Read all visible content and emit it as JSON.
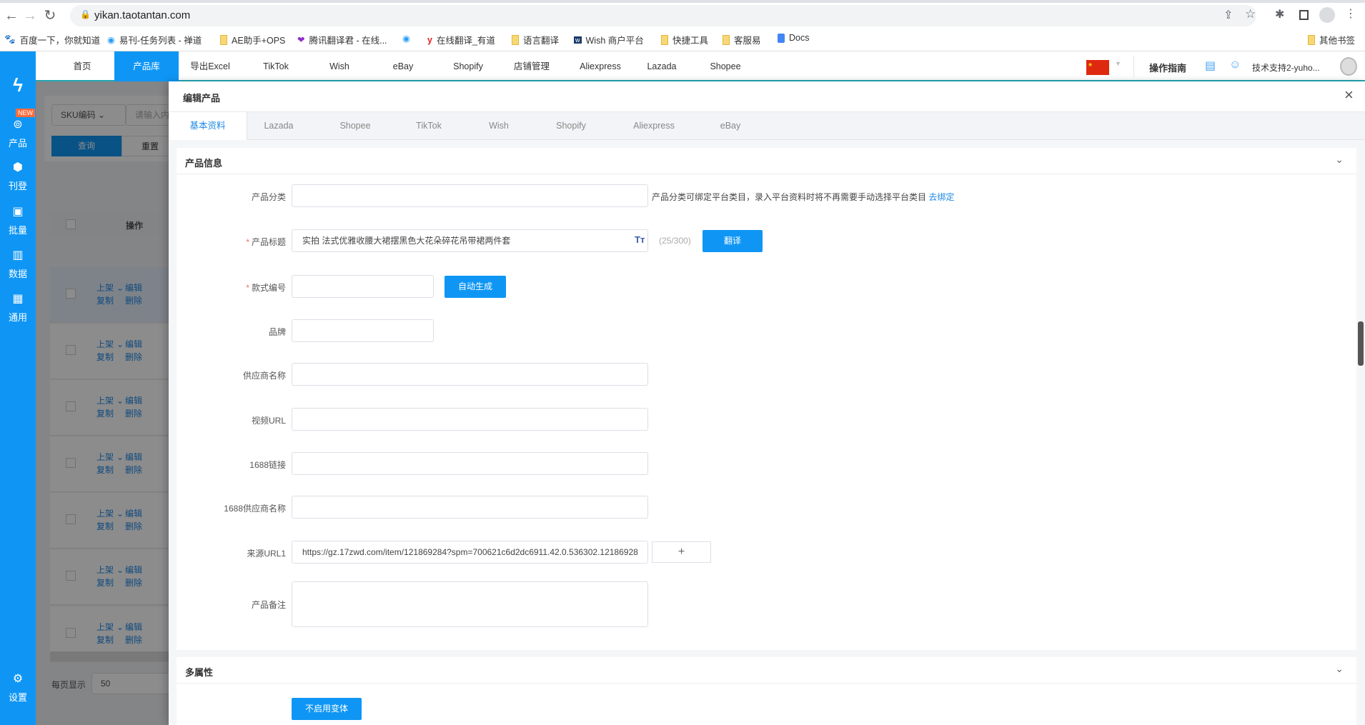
{
  "browser": {
    "url": "yikan.taotantan.com",
    "bookmarks": [
      "百度一下，你就知道",
      "易刊-任务列表 - 禅道",
      "AE助手+OPS",
      "腾讯翻译君 - 在线...",
      "",
      "在线翻译_有道",
      "语言翻译",
      "Wish 商户平台",
      "快捷工具",
      "客服易",
      "Docs"
    ],
    "other_bookmarks": "其他书签"
  },
  "sidebar": {
    "new_badge": "NEW",
    "items": [
      {
        "label": "产品",
        "icon": "product-icon"
      },
      {
        "label": "刊登",
        "icon": "cube-icon"
      },
      {
        "label": "批量",
        "icon": "batch-icon"
      },
      {
        "label": "数据",
        "icon": "chart-icon"
      },
      {
        "label": "通用",
        "icon": "grid-icon"
      }
    ],
    "settings": "设置"
  },
  "topnav": {
    "items": [
      "首页",
      "产品库",
      "导出Excel",
      "TikTok",
      "Wish",
      "eBay",
      "Shopify",
      "店铺管理",
      "Aliexpress",
      "Lazada",
      "Shopee"
    ],
    "active": "产品库",
    "guide": "操作指南",
    "user": "技术支持2-yuho..."
  },
  "background": {
    "filter_select": "SKU编码",
    "filter_placeholder": "请输入内",
    "query": "查询",
    "reset": "重置",
    "col_action": "操作",
    "row_actions": {
      "list": "上架",
      "edit": "编辑",
      "copy": "复制",
      "delete": "删除"
    },
    "page_size_label": "每页显示",
    "page_size": "50"
  },
  "modal": {
    "title": "编辑产品",
    "tabs": [
      "基本资料",
      "Lazada",
      "Shopee",
      "TikTok",
      "Wish",
      "Shopify",
      "Aliexpress",
      "eBay"
    ],
    "active_tab": "基本资料",
    "section1": {
      "title": "产品信息",
      "category": {
        "label": "产品分类",
        "value": "",
        "hint": "产品分类可绑定平台类目，录入平台资料时将不再需要手动选择平台类目",
        "bind_link": "去绑定"
      },
      "title_field": {
        "label": "产品标题",
        "value": "实拍 法式优雅收腰大裙摆黑色大花朵碎花吊带裙两件套",
        "count": "(25/300)",
        "translate": "翻译"
      },
      "style_no": {
        "label": "款式编号",
        "value": "",
        "auto": "自动生成"
      },
      "brand": {
        "label": "品牌",
        "value": ""
      },
      "supplier": {
        "label": "供应商名称",
        "value": ""
      },
      "video": {
        "label": "视频URL",
        "value": ""
      },
      "link1688": {
        "label": "1688链接",
        "value": ""
      },
      "supplier1688": {
        "label": "1688供应商名称",
        "value": ""
      },
      "source_url": {
        "label": "来源URL1",
        "value": "https://gz.17zwd.com/item/121869284?spm=700621c6d2dc6911.42.0.536302.12186928",
        "add": "+"
      },
      "note": {
        "label": "产品备注",
        "value": ""
      }
    },
    "section2": {
      "title": "多属性",
      "no_variant": "不启用变体"
    }
  },
  "colors": {
    "primary": "#0f96f5",
    "accent_line": "#22a6b3",
    "link": "#1e88e5"
  }
}
